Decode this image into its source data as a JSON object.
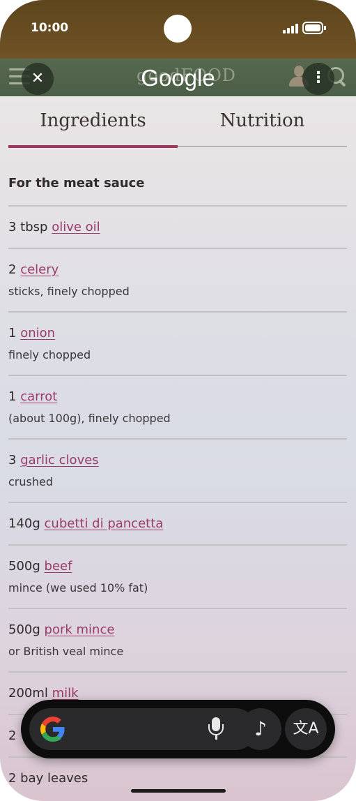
{
  "status_bar": {
    "time": "10:00"
  },
  "header": {
    "site_logo": "goodFOOD",
    "overlay_logo": "Google",
    "close_symbol": "✕",
    "more_symbol": "⋮"
  },
  "tabs": [
    {
      "label": "Ingredients",
      "active": true
    },
    {
      "label": "Nutrition",
      "active": false
    }
  ],
  "ingredients": {
    "section_title": "For the meat sauce",
    "items": [
      {
        "qty": "3 tbsp",
        "link": "olive oil",
        "note": ""
      },
      {
        "qty": "2",
        "link": "celery",
        "note": "sticks, finely chopped"
      },
      {
        "qty": "1",
        "link": "onion",
        "note": "finely chopped"
      },
      {
        "qty": "1",
        "link": "carrot",
        "note": "(about 100g), finely chopped"
      },
      {
        "qty": "3",
        "link": "garlic cloves",
        "note": "crushed"
      },
      {
        "qty": "140g",
        "link": "cubetti di pancetta",
        "note": ""
      },
      {
        "qty": "500g",
        "link": "beef",
        "note": "mince (we used 10% fat)"
      },
      {
        "qty": "500g",
        "link": "pork mince",
        "note": "or British veal mince"
      },
      {
        "qty": "200ml",
        "link": "milk",
        "note": ""
      },
      {
        "qty": "2",
        "link": "",
        "note": ""
      },
      {
        "qty": "2 bay leaves",
        "link": "",
        "note": ""
      }
    ]
  },
  "lens_bar": {
    "music_symbol": "♪",
    "translate_symbol": "文A"
  },
  "colors": {
    "accent": "#9a3a5e",
    "link": "#9a3a6a",
    "status_bar_bg": "#705326",
    "site_bar_bg": "#4b5e47"
  },
  "icons": [
    "menu-icon",
    "close-icon",
    "user-icon",
    "more-icon",
    "search-icon",
    "google-g-icon",
    "mic-icon",
    "music-note-icon",
    "translate-icon"
  ]
}
